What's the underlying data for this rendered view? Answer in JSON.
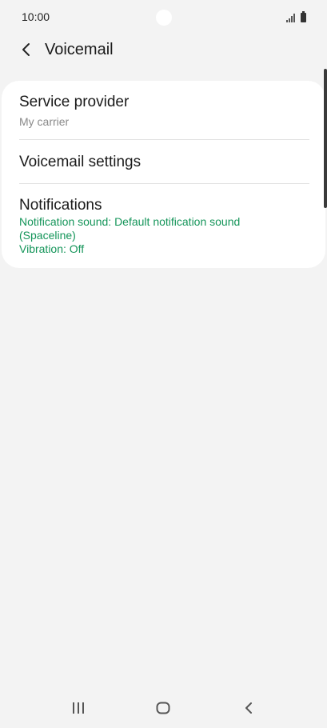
{
  "status_bar": {
    "time": "10:00"
  },
  "header": {
    "title": "Voicemail",
    "back_icon": "chevron-left-icon"
  },
  "settings": {
    "items": [
      {
        "title": "Service provider",
        "subtitle": "My carrier"
      },
      {
        "title": "Voicemail settings"
      },
      {
        "title": "Notifications",
        "details": [
          "Notification sound: Default notification sound",
          "(Spaceline)",
          "Vibration: Off"
        ]
      }
    ]
  },
  "colors": {
    "background": "#f3f3f3",
    "card": "#ffffff",
    "accent_green": "#15955a",
    "subtitle_gray": "#8a8a8a"
  },
  "nav_bar": {
    "icons": [
      "recents-icon",
      "home-icon",
      "back-icon"
    ]
  }
}
